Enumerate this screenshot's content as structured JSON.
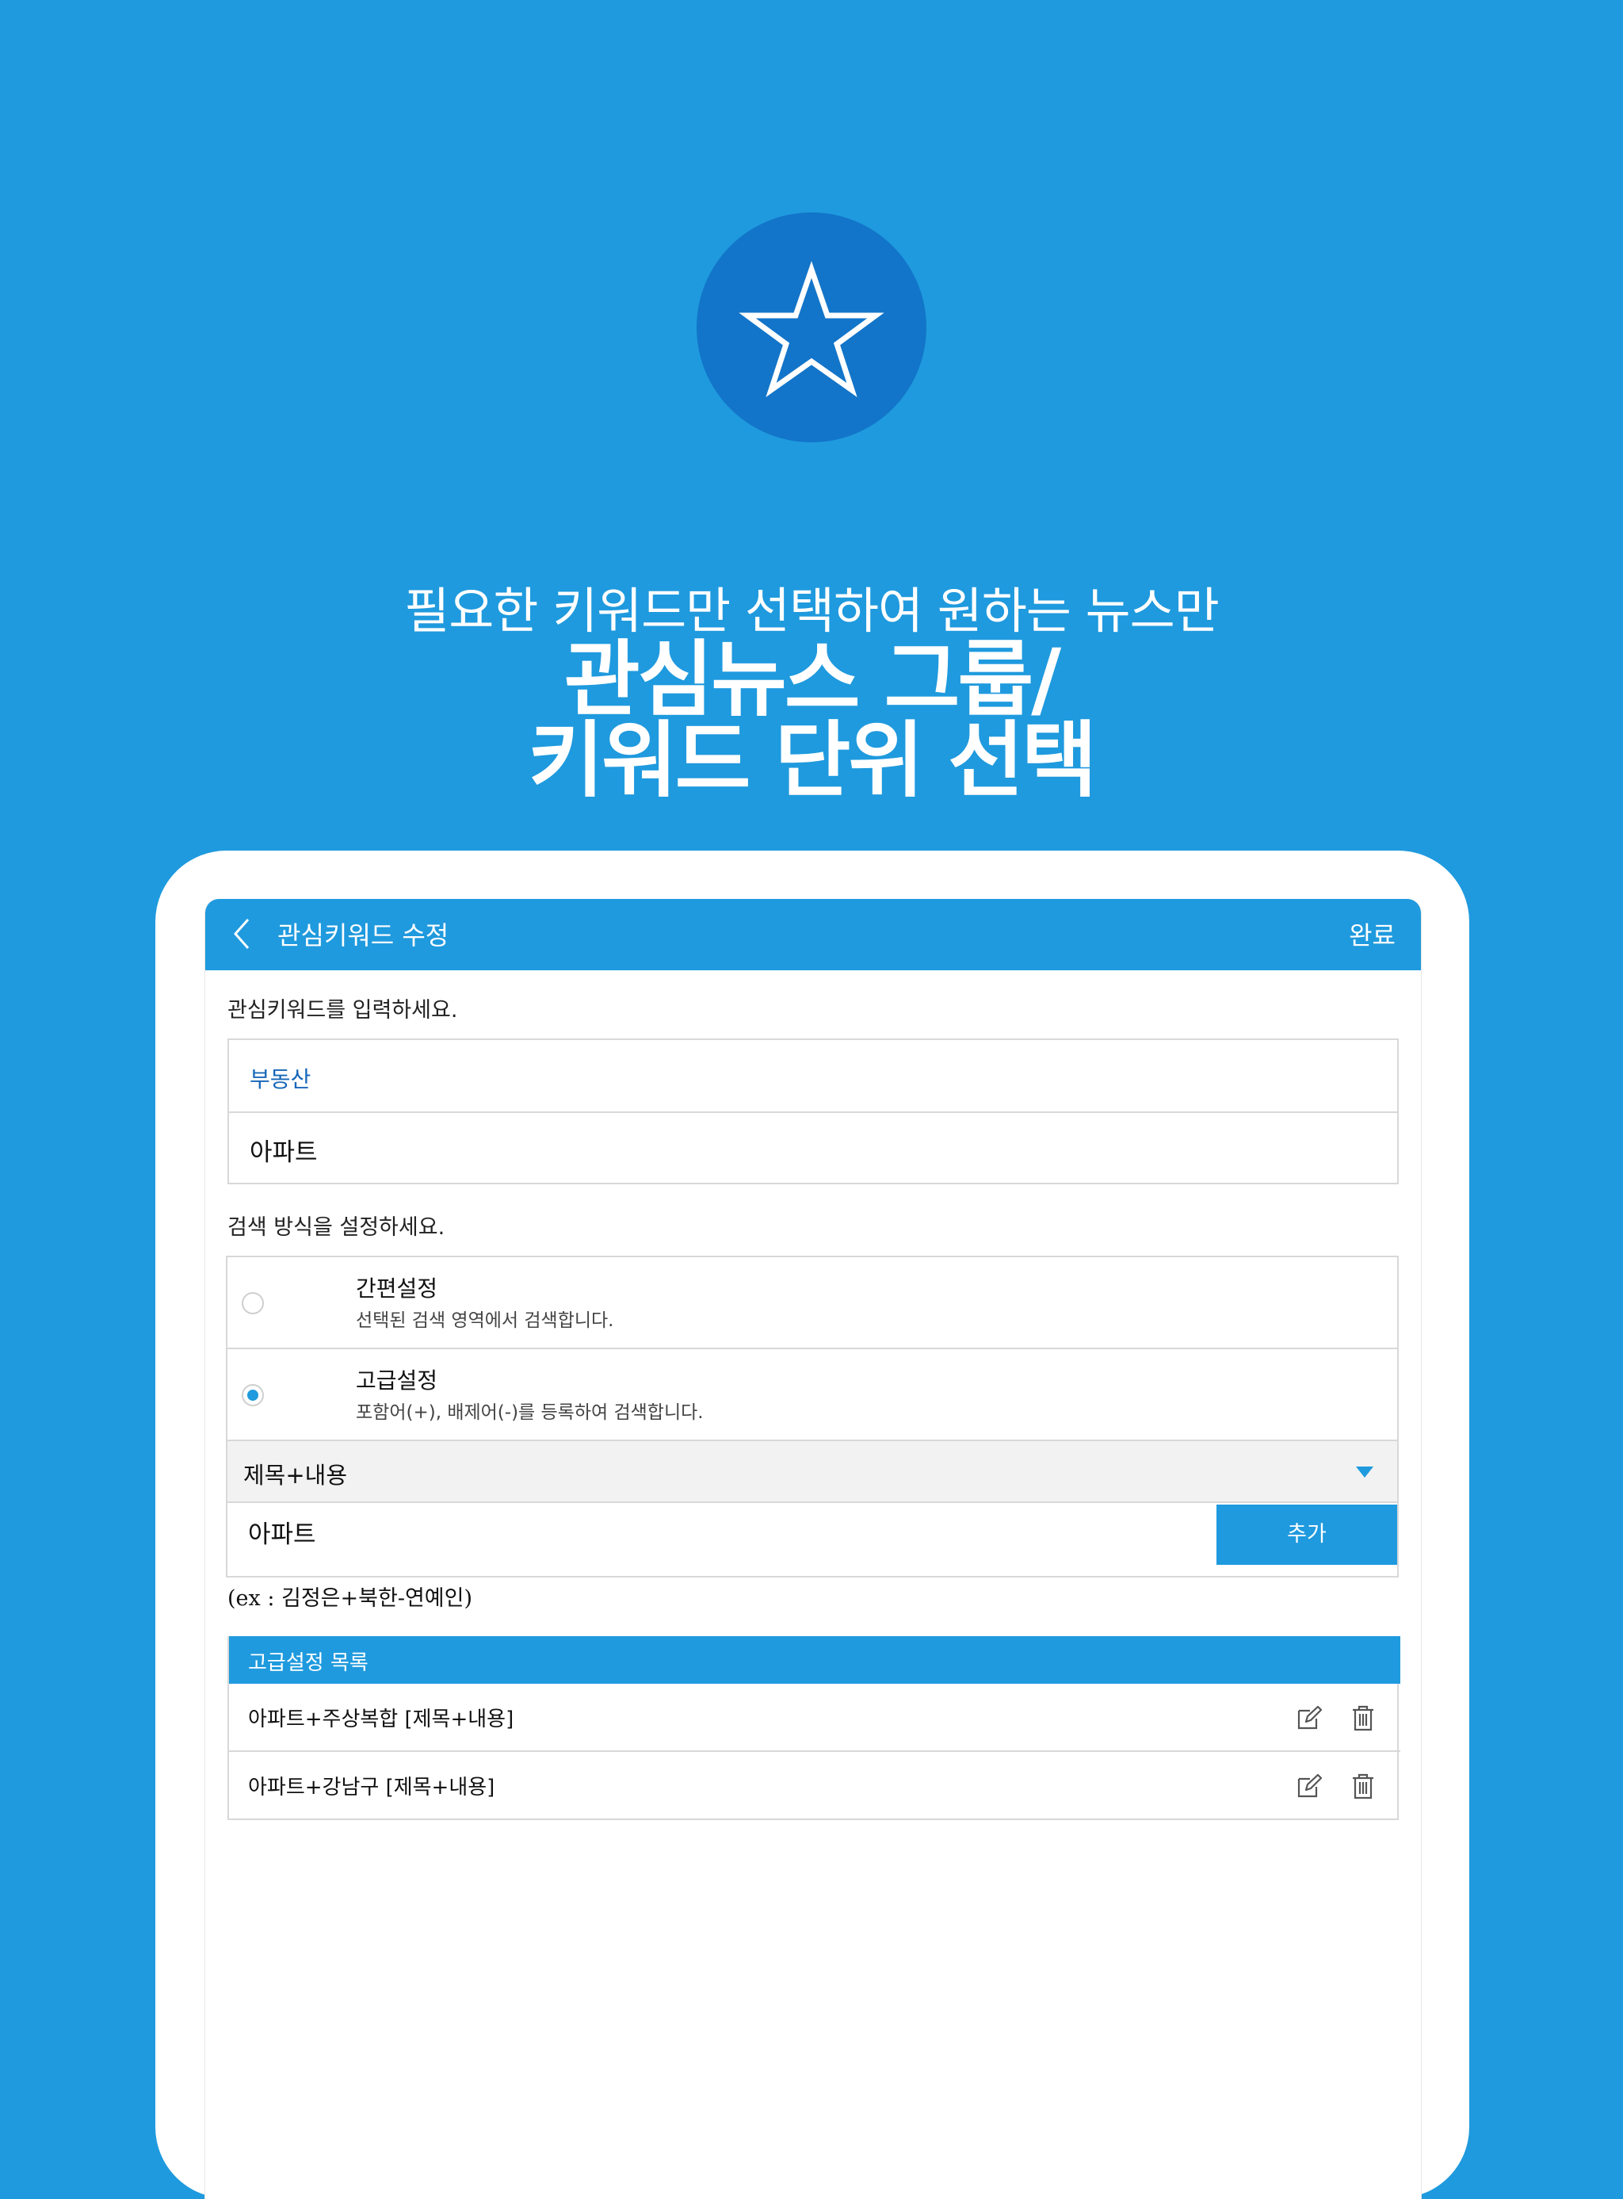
{
  "promo": {
    "tagline": "필요한 키워드만 선택하여 원하는 뉴스만",
    "headline_line1": "관심뉴스 그룹/",
    "headline_line2": "키워드 단위 선택"
  },
  "appbar": {
    "title": "관심키워드 수정",
    "done_label": "완료"
  },
  "keyword_section": {
    "prompt": "관심키워드를 입력하세요.",
    "group": "부동산",
    "keyword": "아파트"
  },
  "search_section": {
    "prompt": "검색 방식을 설정하세요.",
    "options": [
      {
        "name": "간편설정",
        "desc": "선택된 검색 영역에서 검색합니다.",
        "selected": false
      },
      {
        "name": "고급설정",
        "desc": "포함어(+), 배제어(-)를 등록하여 검색합니다.",
        "selected": true
      }
    ],
    "scope_select": "제목+내용",
    "input_value": "아파트",
    "add_label": "추가",
    "example": "(ex : 김정은+북한-연예인)"
  },
  "advanced_list": {
    "header": "고급설정 목록",
    "items": [
      "아파트+주상복합 [제목+내용]",
      "아파트+강남구 [제목+내용]"
    ]
  },
  "colors": {
    "brand_blue": "#1f9ade",
    "dark_blue": "#1275c9",
    "group_text": "#1667b8"
  }
}
